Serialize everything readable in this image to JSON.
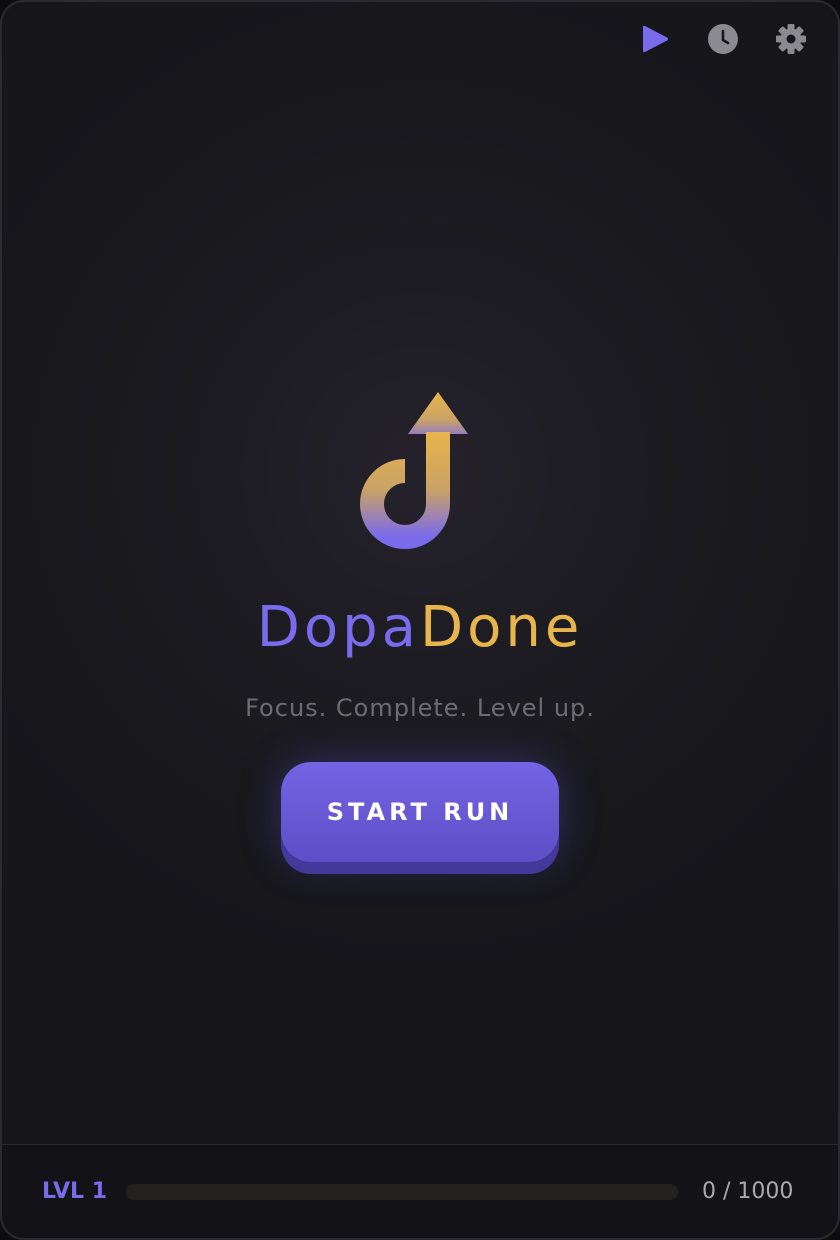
{
  "toolbar": {
    "buttons": [
      {
        "icon": "play-icon",
        "active": true
      },
      {
        "icon": "clock-icon",
        "active": false
      },
      {
        "icon": "gear-icon",
        "active": false
      }
    ]
  },
  "brand": {
    "name_part1": "Dopa",
    "name_part2": "Done",
    "tagline": "Focus. Complete. Level up."
  },
  "actions": {
    "start_label": "START RUN"
  },
  "status": {
    "level_label": "LVL 1",
    "xp_text": "0 / 1000",
    "xp_current": 0,
    "xp_max": 1000
  },
  "colors": {
    "accent_purple": "#7a6aec",
    "accent_gold": "#e8b54c",
    "background": "#16161b",
    "icon_muted": "#8a8a90"
  }
}
